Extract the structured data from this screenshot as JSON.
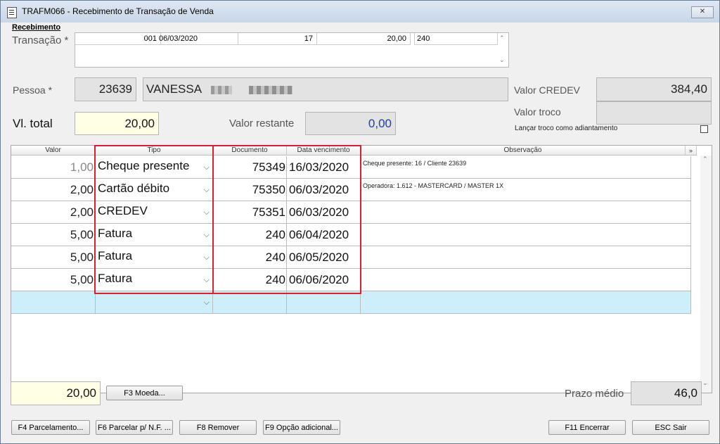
{
  "window": {
    "title": "TRAFM066 - Recebimento de Transação de Venda",
    "close_icon": "close-icon"
  },
  "section": {
    "label": "Recebimento"
  },
  "transacao": {
    "label": "Transação *",
    "f1": "001",
    "date": "06/03/2020",
    "f3": "17",
    "f4": "20,00",
    "f5": "240"
  },
  "pessoa": {
    "label": "Pessoa *",
    "code": "23639",
    "name": "VANESSA"
  },
  "valor_credev": {
    "label": "Valor CREDEV",
    "value": "384,40"
  },
  "valor_troco": {
    "label": "Valor troco",
    "value": ""
  },
  "lancar_troco": {
    "label": "Lançar troco como adiantamento",
    "checked": false
  },
  "vl_total": {
    "label": "Vl. total",
    "value": "20,00"
  },
  "valor_restante": {
    "label": "Valor restante",
    "value": "0,00"
  },
  "grid": {
    "columns": [
      "Valor",
      "Tipo",
      "Documento",
      "Data vencimento",
      "Observação"
    ],
    "rows": [
      {
        "valor": "1,00",
        "tipo": "Cheque presente",
        "documento": "75349",
        "vencimento": "16/03/2020",
        "obs": "Cheque presente: 16 / Cliente 23639"
      },
      {
        "valor": "2,00",
        "tipo": "Cartão débito",
        "documento": "75350",
        "vencimento": "06/03/2020",
        "obs": "Operadora: 1.612 - MASTERCARD / MASTER 1X"
      },
      {
        "valor": "2,00",
        "tipo": "CREDEV",
        "documento": "75351",
        "vencimento": "06/03/2020",
        "obs": ""
      },
      {
        "valor": "5,00",
        "tipo": "Fatura",
        "documento": "240",
        "vencimento": "06/04/2020",
        "obs": ""
      },
      {
        "valor": "5,00",
        "tipo": "Fatura",
        "documento": "240",
        "vencimento": "06/05/2020",
        "obs": ""
      },
      {
        "valor": "5,00",
        "tipo": "Fatura",
        "documento": "240",
        "vencimento": "06/06/2020",
        "obs": ""
      }
    ]
  },
  "footer": {
    "total": "20,00",
    "moeda_btn": "F3 Moeda...",
    "prazo_label": "Prazo médio",
    "prazo_value": "46,0"
  },
  "buttons": {
    "parcelamento": "F4 Parcelamento...",
    "parcelar_nf": "F6 Parcelar p/ N.F. ...",
    "remover": "F8 Remover",
    "opcao": "F9 Opção adicional...",
    "encerrar": "F11 Encerrar",
    "sair": "ESC Sair"
  },
  "colors": {
    "highlight": "#d9202e",
    "new_row": "#cdeffb",
    "yellow_field": "#ffffe6",
    "blue_value": "#1a3fb0"
  }
}
